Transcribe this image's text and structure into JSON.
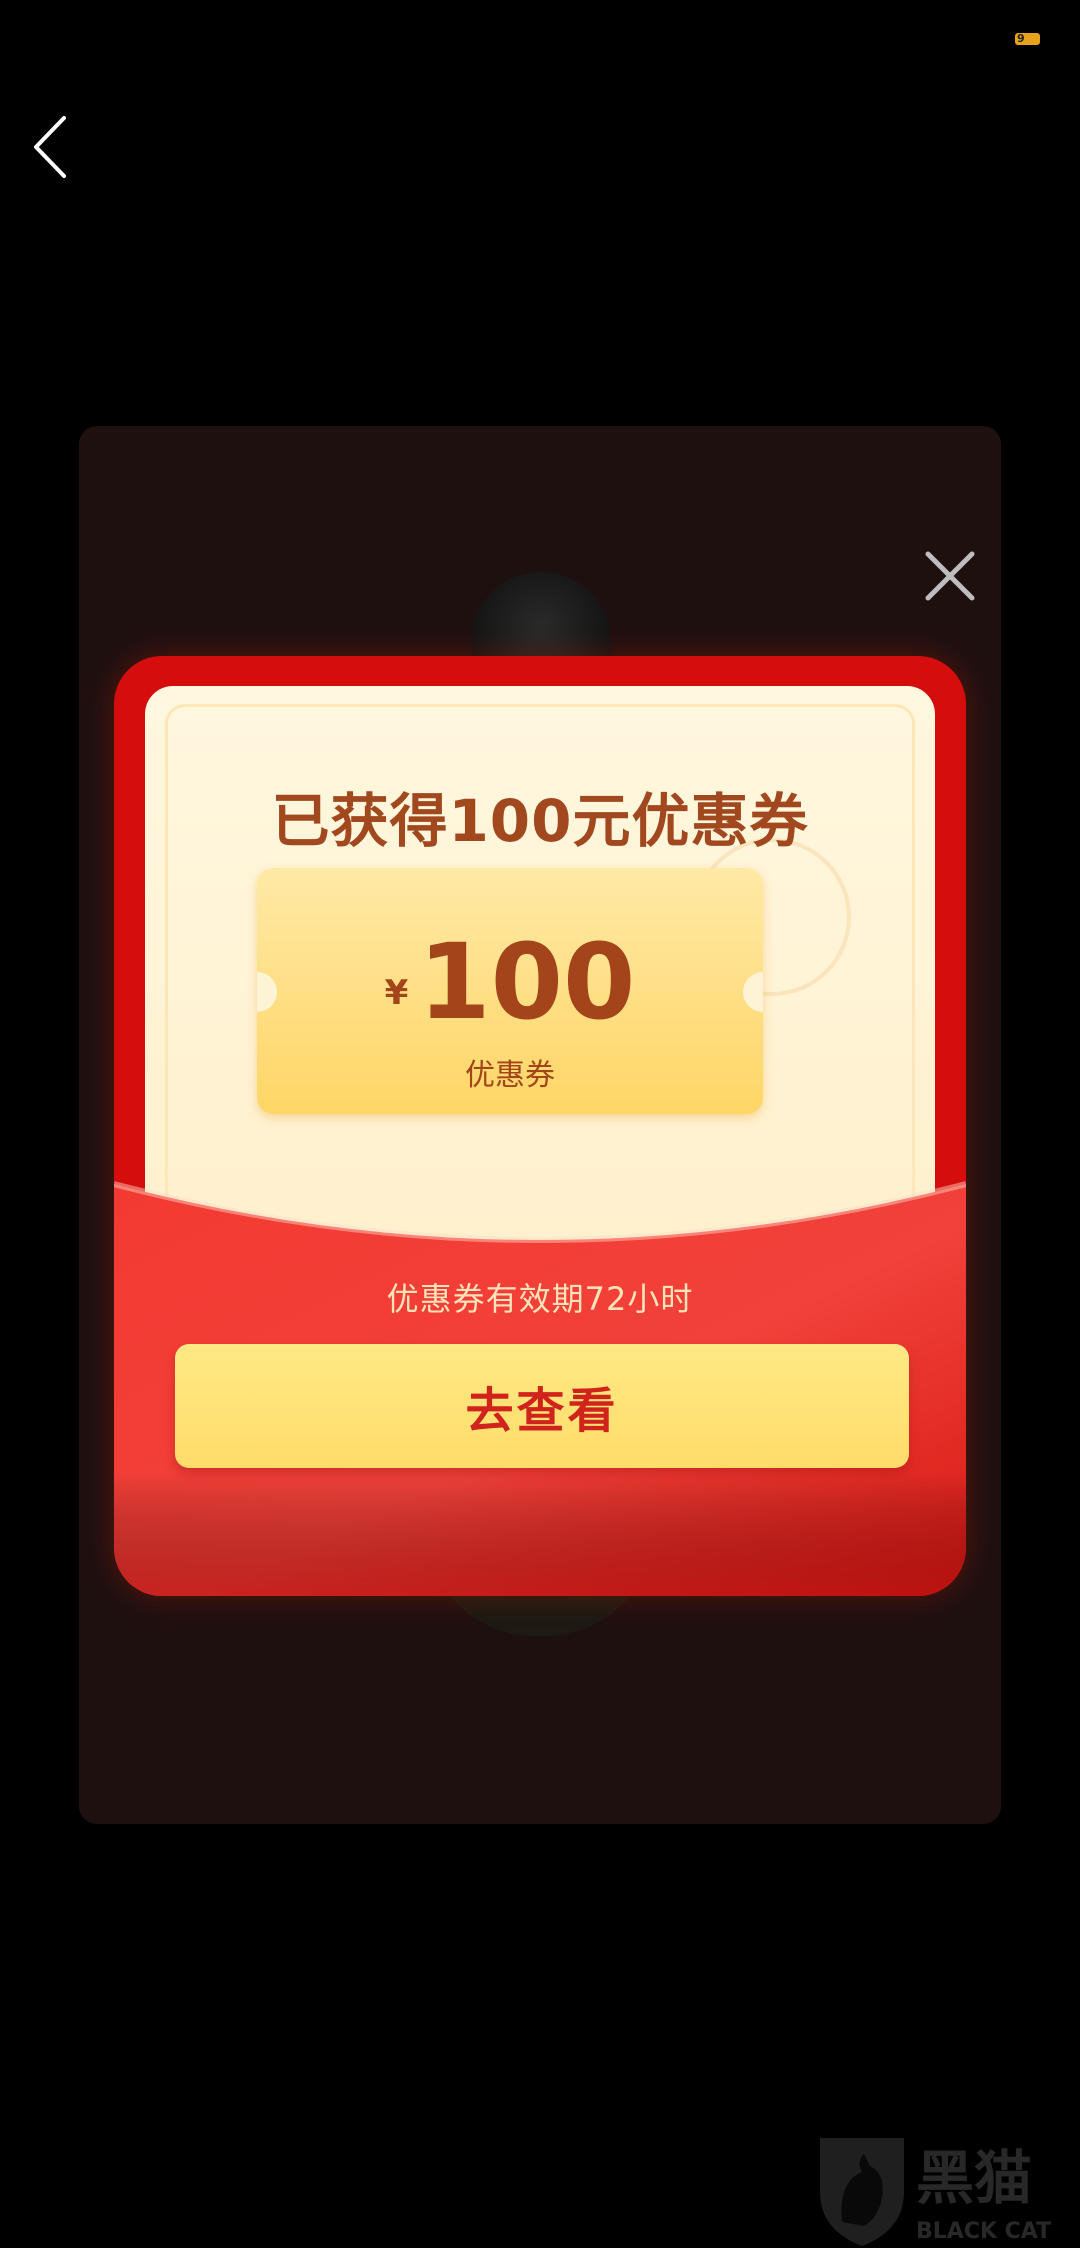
{
  "status": {
    "battery_level": "9"
  },
  "dialog": {
    "title": "已获得100元优惠券",
    "coupon": {
      "currency_symbol": "¥",
      "amount": "100",
      "label": "优惠券"
    },
    "validity_text": "优惠券有效期72小时",
    "action_label": "去查看"
  },
  "icons": {
    "back": "chevron-left-icon",
    "close": "close-icon",
    "watermark": "black-cat-logo"
  },
  "colors": {
    "envelope_red": "#d50d0d",
    "title_brown": "#a1481f",
    "button_yellow": "#ffdc6a",
    "button_text": "#d0231c"
  },
  "watermark": {
    "logo_text": "黑猫",
    "logo_subtext": "BLACK CAT"
  }
}
